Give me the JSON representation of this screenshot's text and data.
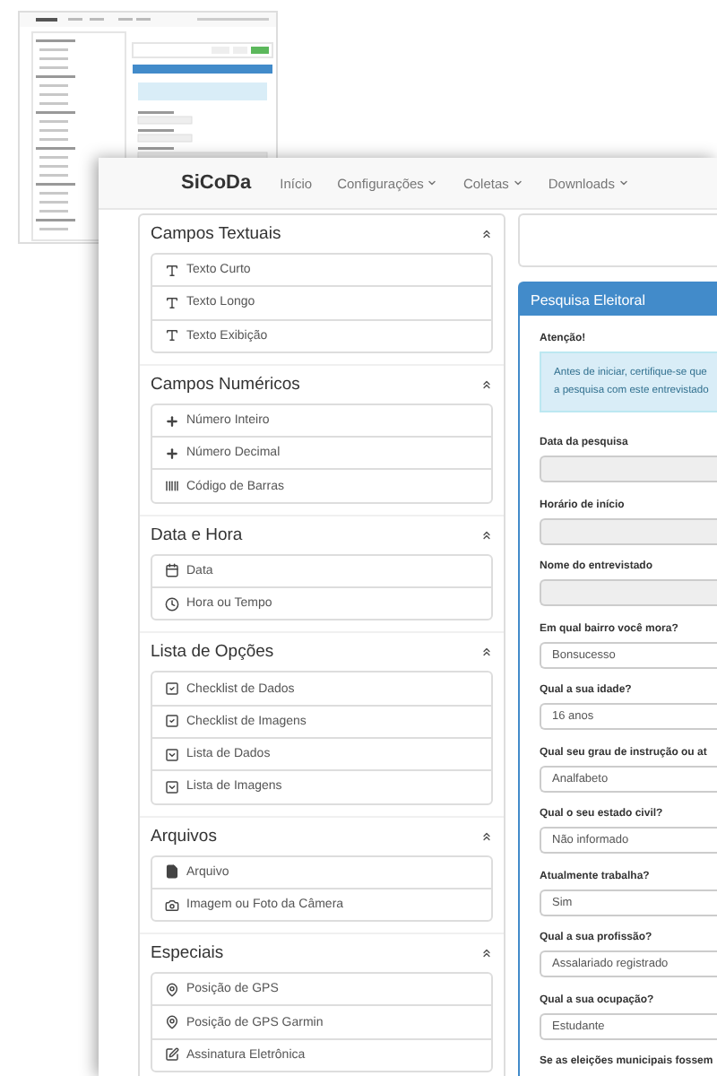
{
  "navbar": {
    "brand": "SiCoDa",
    "items": [
      {
        "label": "Início",
        "dropdown": false
      },
      {
        "label": "Configurações",
        "dropdown": true
      },
      {
        "label": "Coletas",
        "dropdown": true
      },
      {
        "label": "Downloads",
        "dropdown": true
      }
    ]
  },
  "toolbox": {
    "sections": [
      {
        "title": "Campos Textuais",
        "expanded": true,
        "items": [
          {
            "label": "Texto Curto",
            "kind": "text"
          },
          {
            "label": "Texto Longo",
            "kind": "text"
          },
          {
            "label": "Texto Exibição",
            "kind": "text"
          }
        ]
      },
      {
        "title": "Campos Numéricos",
        "expanded": true,
        "items": [
          {
            "label": "Número Inteiro",
            "kind": "number"
          },
          {
            "label": "Número Decimal",
            "kind": "number"
          },
          {
            "label": "Código de Barras",
            "kind": "barcode"
          }
        ]
      },
      {
        "title": "Data e Hora",
        "expanded": true,
        "items": [
          {
            "label": "Data",
            "kind": "date"
          },
          {
            "label": "Hora ou Tempo",
            "kind": "time"
          }
        ]
      },
      {
        "title": "Lista de Opções",
        "expanded": true,
        "items": [
          {
            "label": "Checklist de Dados",
            "kind": "checklist"
          },
          {
            "label": "Checklist de Imagens",
            "kind": "checklist"
          },
          {
            "label": "Lista de Dados",
            "kind": "list"
          },
          {
            "label": "Lista de Imagens",
            "kind": "list"
          }
        ]
      },
      {
        "title": "Arquivos",
        "expanded": true,
        "items": [
          {
            "label": "Arquivo",
            "kind": "file"
          },
          {
            "label": "Imagem ou Foto da Câmera",
            "kind": "camera"
          }
        ]
      },
      {
        "title": "Especiais",
        "expanded": true,
        "items": [
          {
            "label": "Posição de GPS",
            "kind": "gps"
          },
          {
            "label": "Posição de GPS Garmin",
            "kind": "gps"
          },
          {
            "label": "Assinatura Eletrônica",
            "kind": "signature"
          }
        ]
      }
    ]
  },
  "form": {
    "title": "Pesquisa Eleitoral",
    "alert": {
      "heading": "Atenção!",
      "lines": [
        "Antes de iniciar, certifique-se que",
        "a pesquisa com este entrevistado"
      ]
    },
    "fields": [
      {
        "label": "Data da pesquisa",
        "kind": "input"
      },
      {
        "label": "Horário de início",
        "kind": "input"
      },
      {
        "label": "Nome do entrevistado",
        "kind": "input"
      },
      {
        "label": "Em qual bairro você mora?",
        "kind": "select",
        "value": "Bonsucesso"
      },
      {
        "label": "Qual a sua idade?",
        "kind": "select",
        "value": "16 anos"
      },
      {
        "label": "Qual seu grau de instrução ou at",
        "kind": "select",
        "value": "Analfabeto"
      },
      {
        "label": "Qual o seu estado civil?",
        "kind": "select",
        "value": "Não informado"
      },
      {
        "label": "Atualmente trabalha?",
        "kind": "select",
        "value": "Sim"
      },
      {
        "label": "Qual a sua profissão?",
        "kind": "select",
        "value": "Assalariado registrado"
      },
      {
        "label": "Qual a sua ocupação?",
        "kind": "select",
        "value": "Estudante"
      },
      {
        "label": "Se as eleições municipais fossem",
        "kind": "label"
      }
    ]
  }
}
